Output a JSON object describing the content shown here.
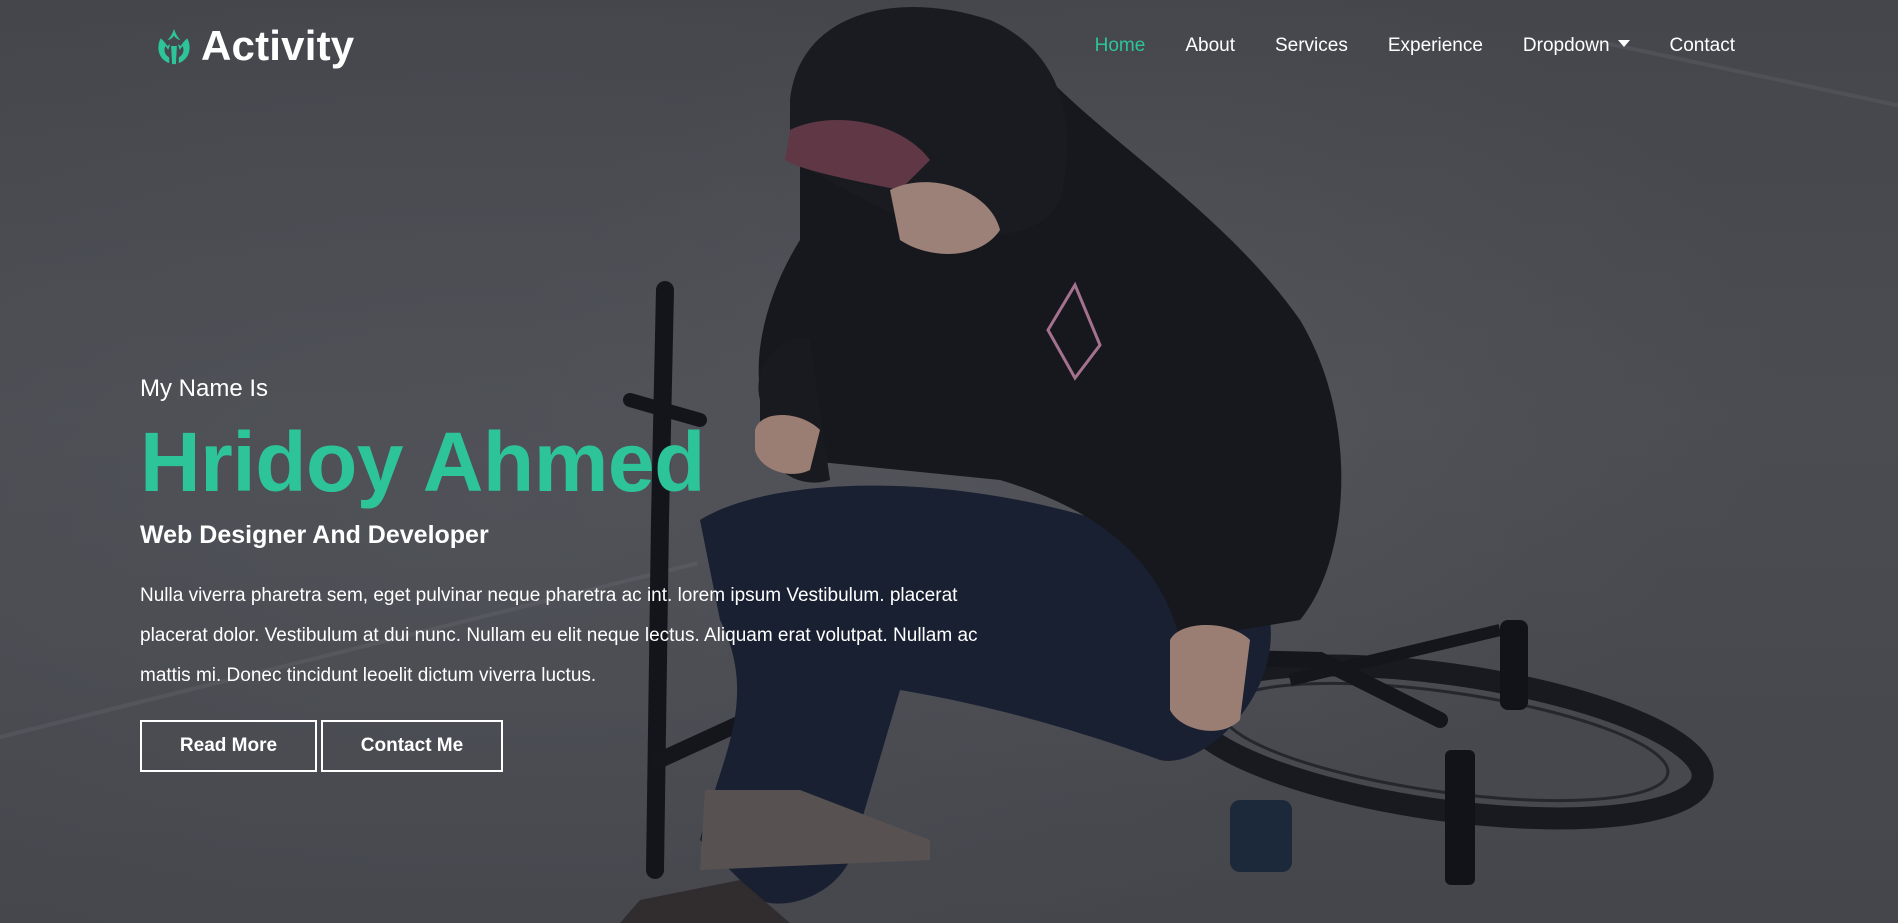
{
  "brand": {
    "name": "Activity",
    "icon": "rebel-alliance-icon",
    "accent_color": "#2ec49a"
  },
  "nav": {
    "items": [
      {
        "label": "Home",
        "active": true
      },
      {
        "label": "About"
      },
      {
        "label": "Services"
      },
      {
        "label": "Experience"
      },
      {
        "label": "Dropdown",
        "has_caret": true
      },
      {
        "label": "Contact"
      }
    ]
  },
  "hero": {
    "intro": "My Name Is",
    "name": "Hridoy Ahmed",
    "role": "Web Designer And Developer",
    "description": "Nulla viverra pharetra sem, eget pulvinar neque pharetra ac int. lorem ipsum Vestibulum. placerat placerat dolor. Vestibulum at dui nunc. Nullam eu elit neque lectus. Aliquam erat volutpat. Nullam ac mattis mi. Donec tincidunt leoelit dictum viverra luctus.",
    "buttons": {
      "read_more": "Read More",
      "contact_me": "Contact Me"
    },
    "background_image": "person-with-bmx-bike"
  }
}
